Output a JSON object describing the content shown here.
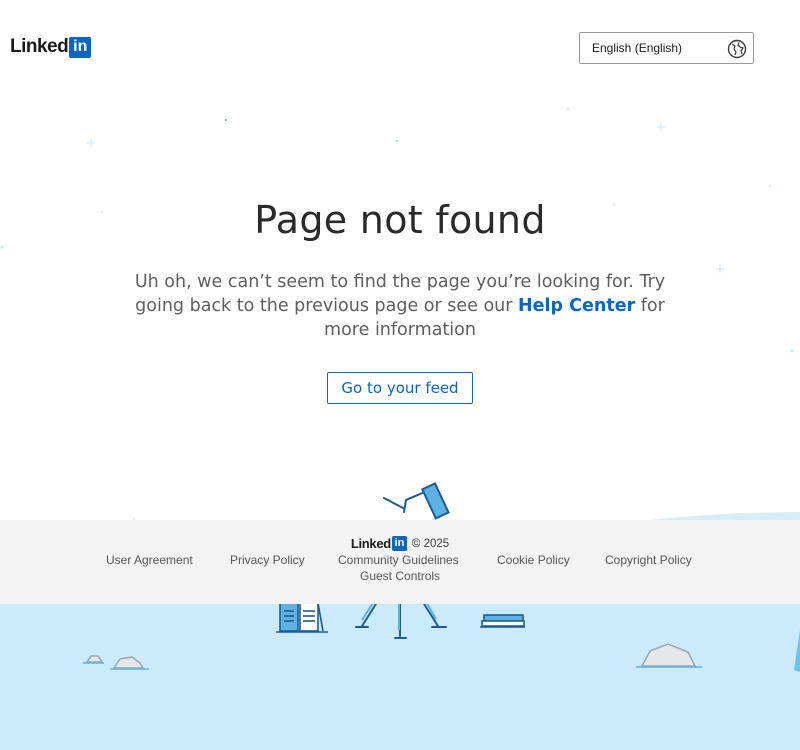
{
  "header": {
    "logo_word": "Linked",
    "logo_box": "in",
    "language": "English (English)"
  },
  "main": {
    "title": "Page not found",
    "message_before": "Uh oh, we can’t seem to find the page you’re looking for. Try going back to the previous page or see our ",
    "help_link": "Help Center",
    "message_after": " for more information",
    "feed_button": "Go to your feed"
  },
  "footer": {
    "logo_word": "Linked",
    "logo_box": "in",
    "copyright": "© 2025",
    "links": {
      "user_agreement": "User Agreement",
      "privacy_policy": "Privacy Policy",
      "community_guidelines": "Community Guidelines",
      "cookie_policy": "Cookie Policy",
      "copyright_policy": "Copyright Policy",
      "guest_controls": "Guest Controls"
    }
  },
  "colors": {
    "brand": "#0a66c2",
    "water": "#cbeafc",
    "footer_bg": "#f3f3f3"
  }
}
